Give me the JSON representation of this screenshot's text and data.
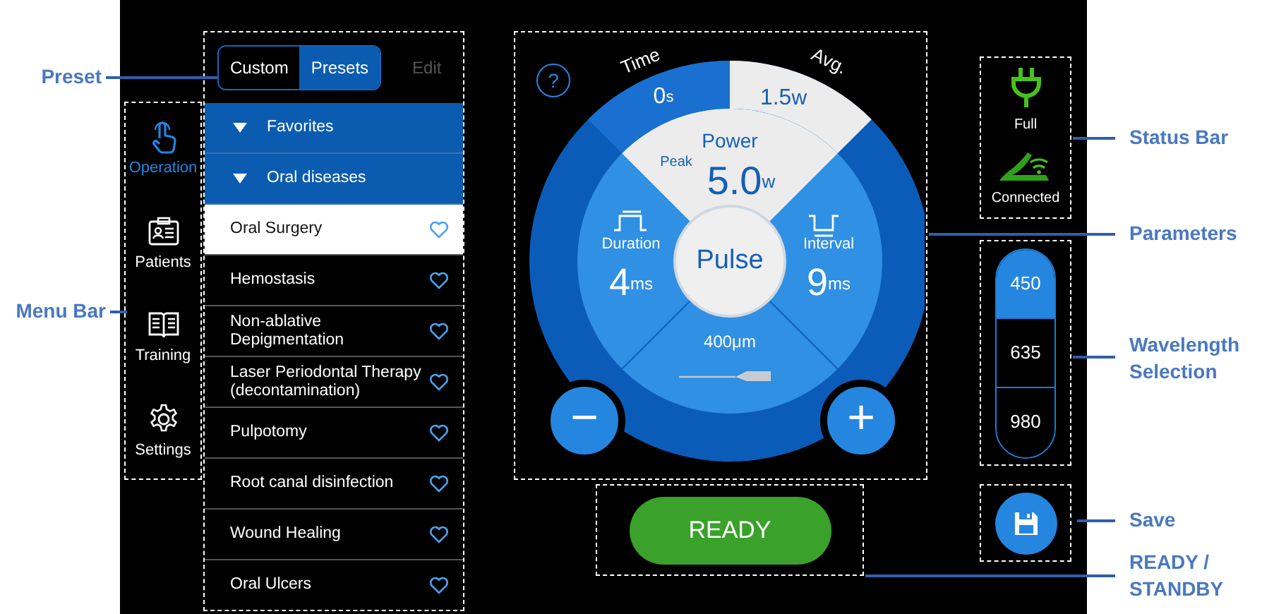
{
  "callouts": {
    "left": [
      {
        "label": "Preset"
      },
      {
        "label": "Menu Bar"
      }
    ],
    "right": [
      {
        "label": "Status Bar"
      },
      {
        "label": "Parameters"
      },
      {
        "label": "Wavelength Selection"
      },
      {
        "label": "Save"
      },
      {
        "label": "READY / STANDBY"
      }
    ]
  },
  "menu": [
    {
      "label": "Operation",
      "selected": true
    },
    {
      "label": "Patients",
      "selected": false
    },
    {
      "label": "Training",
      "selected": false
    },
    {
      "label": "Settings",
      "selected": false
    }
  ],
  "preset": {
    "modes": [
      {
        "label": "Custom",
        "selected": false
      },
      {
        "label": "Presets",
        "selected": true
      }
    ],
    "edit": {
      "label": "Edit",
      "disabled": true
    },
    "rows": [
      {
        "kind": "group",
        "label": "Favorites",
        "expanded": true
      },
      {
        "kind": "group",
        "label": "Oral diseases",
        "expanded": true
      },
      {
        "kind": "item",
        "label": "Oral Surgery",
        "selected": true,
        "favorite": false
      },
      {
        "kind": "item",
        "label": "Hemostasis",
        "selected": false,
        "favorite": false
      },
      {
        "kind": "item",
        "label": "Non-ablative Depigmentation",
        "selected": false,
        "favorite": false
      },
      {
        "kind": "item",
        "label": "Laser Periodontal Therapy (decontamination)",
        "selected": false,
        "favorite": false
      },
      {
        "kind": "item",
        "label": "Pulpotomy",
        "selected": false,
        "favorite": false
      },
      {
        "kind": "item",
        "label": "Root canal disinfection",
        "selected": false,
        "favorite": false
      },
      {
        "kind": "item",
        "label": "Wound Healing",
        "selected": false,
        "favorite": false
      },
      {
        "kind": "item",
        "label": "Oral Ulcers",
        "selected": false,
        "favorite": false
      }
    ]
  },
  "parameters": {
    "help": "?",
    "time": {
      "label": "Time",
      "value": "0",
      "unit": "s"
    },
    "average": {
      "label": "Avg.",
      "value": "1.5",
      "unit": "w"
    },
    "power": {
      "label": "Power",
      "peak_label": "Peak",
      "value": "5.0",
      "unit": "w"
    },
    "duration": {
      "label": "Duration",
      "value": "4",
      "unit": "ms"
    },
    "interval": {
      "label": "Interval",
      "value": "9",
      "unit": "ms"
    },
    "mode": "Pulse",
    "fiber": "400μm",
    "decrease": "−",
    "increase": "+"
  },
  "status": {
    "power": "Full",
    "connection": "Connected"
  },
  "wavelengths": [
    {
      "label": "450",
      "selected": true
    },
    {
      "label": "635",
      "selected": false
    },
    {
      "label": "980",
      "selected": false
    }
  ],
  "ready": {
    "label": "READY"
  }
}
